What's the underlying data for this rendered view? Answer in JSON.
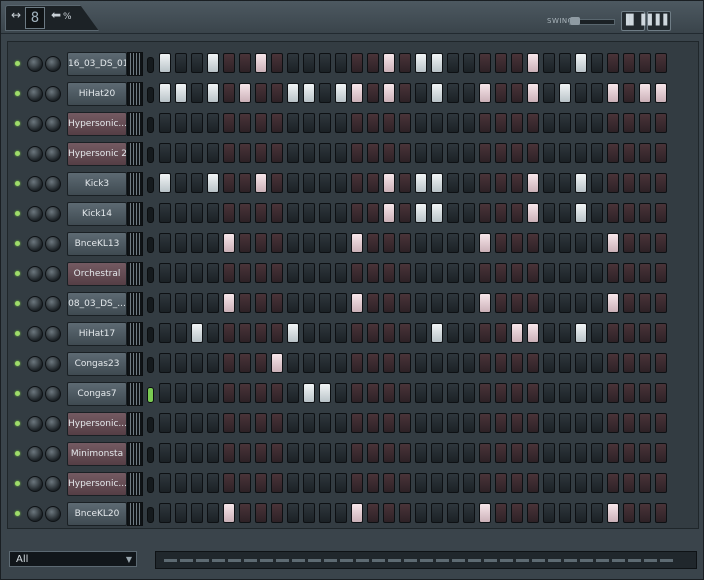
{
  "window": {
    "pattern_number": "8",
    "swing_label": "SWING",
    "view_buttons": [
      "▐▌▐",
      "▌▌▌"
    ]
  },
  "filter": {
    "value": "All"
  },
  "channels": [
    {
      "name": "16_03_DS_01",
      "style": "gray",
      "steps": [
        1,
        0,
        0,
        1,
        0,
        0,
        1,
        0,
        0,
        0,
        0,
        0,
        0,
        0,
        1,
        0,
        1,
        1,
        0,
        0,
        0,
        0,
        0,
        1,
        0,
        0,
        1,
        0,
        0,
        0,
        0,
        0
      ],
      "led_on": false
    },
    {
      "name": "HiHat20",
      "style": "gray",
      "steps": [
        1,
        1,
        0,
        1,
        0,
        1,
        0,
        0,
        1,
        1,
        0,
        1,
        1,
        0,
        1,
        0,
        0,
        1,
        0,
        0,
        1,
        0,
        0,
        1,
        0,
        1,
        0,
        0,
        1,
        0,
        1,
        1
      ],
      "led_on": false
    },
    {
      "name": "Hypersonic...",
      "style": "pink",
      "steps": [
        0,
        0,
        0,
        0,
        0,
        0,
        0,
        0,
        0,
        0,
        0,
        0,
        0,
        0,
        0,
        0,
        0,
        0,
        0,
        0,
        0,
        0,
        0,
        0,
        0,
        0,
        0,
        0,
        0,
        0,
        0,
        0
      ],
      "led_on": false
    },
    {
      "name": "Hypersonic 2",
      "style": "pink",
      "steps": [
        0,
        0,
        0,
        0,
        0,
        0,
        0,
        0,
        0,
        0,
        0,
        0,
        0,
        0,
        0,
        0,
        0,
        0,
        0,
        0,
        0,
        0,
        0,
        0,
        0,
        0,
        0,
        0,
        0,
        0,
        0,
        0
      ],
      "led_on": false
    },
    {
      "name": "Kick3",
      "style": "gray",
      "steps": [
        1,
        0,
        0,
        1,
        0,
        0,
        1,
        0,
        0,
        0,
        0,
        0,
        0,
        0,
        1,
        0,
        1,
        1,
        0,
        0,
        0,
        0,
        0,
        1,
        0,
        0,
        1,
        0,
        0,
        0,
        0,
        0
      ],
      "led_on": false
    },
    {
      "name": "Kick14",
      "style": "gray",
      "steps": [
        0,
        0,
        0,
        0,
        0,
        0,
        0,
        0,
        0,
        0,
        0,
        0,
        0,
        0,
        1,
        0,
        1,
        1,
        0,
        0,
        0,
        0,
        0,
        1,
        0,
        0,
        1,
        0,
        0,
        0,
        0,
        0
      ],
      "led_on": false
    },
    {
      "name": "BnceKL13",
      "style": "gray",
      "steps": [
        0,
        0,
        0,
        0,
        1,
        0,
        0,
        0,
        0,
        0,
        0,
        0,
        1,
        0,
        0,
        0,
        0,
        0,
        0,
        0,
        1,
        0,
        0,
        0,
        0,
        0,
        0,
        0,
        1,
        0,
        0,
        0
      ],
      "led_on": false
    },
    {
      "name": "Orchestral",
      "style": "pink",
      "steps": [
        0,
        0,
        0,
        0,
        0,
        0,
        0,
        0,
        0,
        0,
        0,
        0,
        0,
        0,
        0,
        0,
        0,
        0,
        0,
        0,
        0,
        0,
        0,
        0,
        0,
        0,
        0,
        0,
        0,
        0,
        0,
        0
      ],
      "led_on": false
    },
    {
      "name": "08_03_DS_...",
      "style": "gray",
      "steps": [
        0,
        0,
        0,
        0,
        1,
        0,
        0,
        0,
        0,
        0,
        0,
        0,
        1,
        0,
        0,
        0,
        0,
        0,
        0,
        0,
        1,
        0,
        0,
        0,
        0,
        0,
        0,
        0,
        1,
        0,
        0,
        0
      ],
      "led_on": false
    },
    {
      "name": "HiHat17",
      "style": "gray",
      "steps": [
        0,
        0,
        1,
        0,
        0,
        0,
        0,
        0,
        1,
        0,
        0,
        0,
        0,
        0,
        0,
        0,
        0,
        1,
        0,
        0,
        0,
        0,
        1,
        1,
        0,
        0,
        1,
        0,
        0,
        0,
        0,
        0
      ],
      "led_on": false
    },
    {
      "name": "Congas23",
      "style": "gray",
      "steps": [
        0,
        0,
        0,
        0,
        0,
        0,
        0,
        1,
        0,
        0,
        0,
        0,
        0,
        0,
        0,
        0,
        0,
        0,
        0,
        0,
        0,
        0,
        0,
        0,
        0,
        0,
        0,
        0,
        0,
        0,
        0,
        0
      ],
      "led_on": false
    },
    {
      "name": "Congas7",
      "style": "gray",
      "steps": [
        0,
        0,
        0,
        0,
        0,
        0,
        0,
        0,
        0,
        1,
        1,
        0,
        0,
        0,
        0,
        0,
        0,
        0,
        0,
        0,
        0,
        0,
        0,
        0,
        0,
        0,
        0,
        0,
        0,
        0,
        0,
        0
      ],
      "led_on": true
    },
    {
      "name": "Hypersonic...",
      "style": "pink",
      "steps": [
        0,
        0,
        0,
        0,
        0,
        0,
        0,
        0,
        0,
        0,
        0,
        0,
        0,
        0,
        0,
        0,
        0,
        0,
        0,
        0,
        0,
        0,
        0,
        0,
        0,
        0,
        0,
        0,
        0,
        0,
        0,
        0
      ],
      "led_on": false
    },
    {
      "name": "Minimonsta",
      "style": "pink",
      "steps": [
        0,
        0,
        0,
        0,
        0,
        0,
        0,
        0,
        0,
        0,
        0,
        0,
        0,
        0,
        0,
        0,
        0,
        0,
        0,
        0,
        0,
        0,
        0,
        0,
        0,
        0,
        0,
        0,
        0,
        0,
        0,
        0
      ],
      "led_on": false
    },
    {
      "name": "Hypersonic...",
      "style": "pink",
      "steps": [
        0,
        0,
        0,
        0,
        0,
        0,
        0,
        0,
        0,
        0,
        0,
        0,
        0,
        0,
        0,
        0,
        0,
        0,
        0,
        0,
        0,
        0,
        0,
        0,
        0,
        0,
        0,
        0,
        0,
        0,
        0,
        0
      ],
      "led_on": false
    },
    {
      "name": "BnceKL20",
      "style": "gray",
      "steps": [
        0,
        0,
        0,
        0,
        1,
        0,
        0,
        0,
        0,
        0,
        0,
        0,
        1,
        0,
        0,
        0,
        0,
        0,
        0,
        0,
        1,
        0,
        0,
        0,
        0,
        0,
        0,
        0,
        1,
        0,
        0,
        0
      ],
      "led_on": false
    }
  ]
}
